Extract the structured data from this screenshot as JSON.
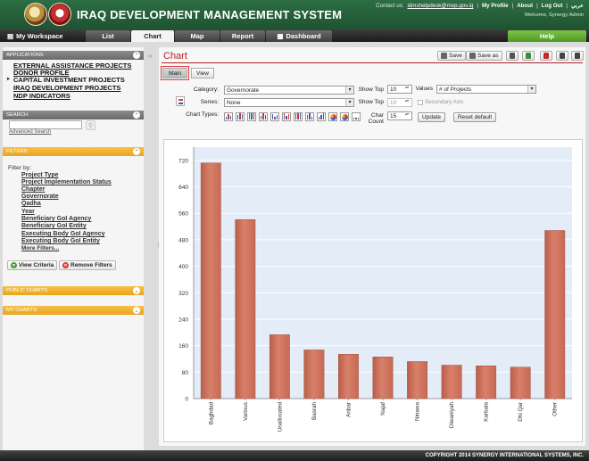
{
  "header": {
    "title": "IRAQ DEVELOPMENT MANAGEMENT SYSTEM",
    "contact_label": "Contact us:",
    "contact_email": "idmshelpdesk@mop.gov.iq",
    "links": [
      "My Profile",
      "About",
      "Log Out",
      "عربي"
    ],
    "welcome": "Welcome, Synergy Admin"
  },
  "nav": {
    "workspace": "My Workspace",
    "tabs": [
      "List",
      "Chart",
      "Map",
      "Report",
      "Dashboard"
    ],
    "active_tab": "Chart",
    "help": "Help"
  },
  "sidebar": {
    "applications_header": "APPLICATIONS",
    "applications": [
      "EXTERNAL ASSISTANCE PROJECTS",
      "DONOR PROFILE",
      "CAPITAL INVESTMENT PROJECTS",
      "IRAQ DEVELOPMENT PROJECTS",
      "NDP INDICATORS"
    ],
    "current_application": "CAPITAL INVESTMENT PROJECTS",
    "search_header": "SEARCH",
    "advanced_search": "Advanced Search",
    "filters_header": "FILTERS",
    "filter_by": "Filter by:",
    "filters": [
      "Project Type",
      "Project Implementation Status",
      "Chapter",
      "Governorate",
      "Qadha",
      "Year",
      "Beneficiary GoI Agency",
      "Beneficiary GoI Entity",
      "Executing Body GoI Agency",
      "Executing Body GoI Entity",
      "More Filters..."
    ],
    "view_criteria": "View Criteria",
    "remove_filters": "Remove Filters",
    "public_charts": "PUBLIC CHARTS",
    "my_charts": "MY CHARTS"
  },
  "main": {
    "title": "Chart",
    "toolbar": {
      "save": "Save",
      "save_as": "Save as"
    },
    "subtabs": [
      "Main",
      "View"
    ],
    "category_label": "Category:",
    "category_value": "Governorate",
    "series_label": "Series:",
    "series_value": "None",
    "show_top_label": "Show Top",
    "show_top_value": "10",
    "show_top2_label": "Show Top",
    "show_top2_value": "10",
    "values_label": "Values",
    "values_value": "# of Projects",
    "secondary_axis": "Secondary Axis",
    "chart_types_label": "Chart Types:",
    "char_count_label": "Char Count",
    "char_count_value": "15",
    "update": "Update",
    "reset_default": "Reset default"
  },
  "chart_data": {
    "type": "bar",
    "categories": [
      "Baghdad",
      "Various",
      "Unallocated",
      "Basrah",
      "Anbar",
      "Najaf",
      "Ninawa",
      "Diwaniyah",
      "Karbala",
      "Dhi Qar",
      "Other"
    ],
    "values": [
      712,
      541,
      193,
      147,
      134,
      126,
      112,
      101,
      99,
      95,
      508
    ],
    "yticks": [
      0,
      80,
      160,
      240,
      320,
      400,
      480,
      560,
      640,
      720
    ],
    "ylim": [
      0,
      760
    ],
    "bar_color": "#d9806a",
    "plot_background": "#e4ecf7"
  },
  "footer": "COPYRIGHT 2014 SYNERGY INTERNATIONAL SYSTEMS, INC."
}
